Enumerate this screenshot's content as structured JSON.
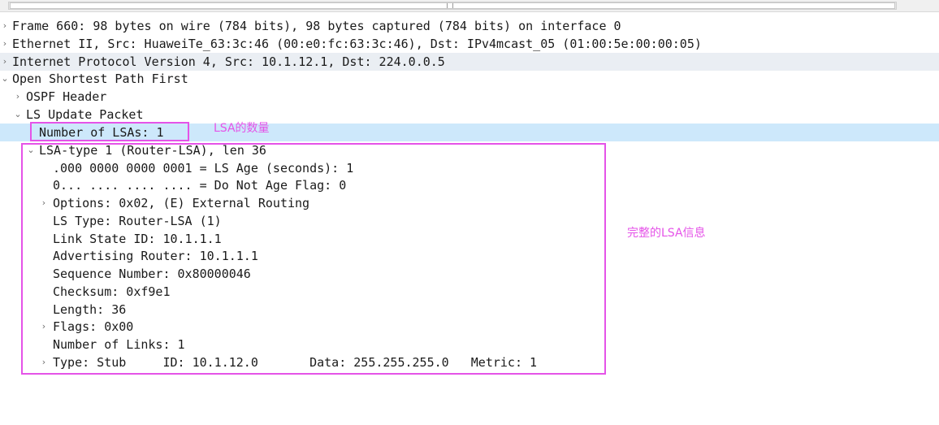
{
  "colors": {
    "annotation": "#e553e8",
    "row_highlight": "#eaeef3",
    "row_selected": "#cde8fb"
  },
  "icons": {
    "collapsed": "chevron-right-icon",
    "expanded": "chevron-down-icon"
  },
  "tree": {
    "frame": "Frame 660: 98 bytes on wire (784 bits), 98 bytes captured (784 bits) on interface 0",
    "ethernet": "Ethernet II, Src: HuaweiTe_63:3c:46 (00:e0:fc:63:3c:46), Dst: IPv4mcast_05 (01:00:5e:00:00:05)",
    "ip": "Internet Protocol Version 4, Src: 10.1.12.1, Dst: 224.0.0.5",
    "ospf": "Open Shortest Path First",
    "ospf_header": "OSPF Header",
    "ls_update": "LS Update Packet",
    "num_lsas": "Number of LSAs: 1",
    "lsa_type": "LSA-type 1 (Router-LSA), len 36",
    "ls_age": ".000 0000 0000 0001 = LS Age (seconds): 1",
    "do_not_age": "0... .... .... .... = Do Not Age Flag: 0",
    "options": "Options: 0x02, (E) External Routing",
    "ls_type": "LS Type: Router-LSA (1)",
    "link_state_id": "Link State ID: 10.1.1.1",
    "adv_router": "Advertising Router: 10.1.1.1",
    "seq_number": "Sequence Number: 0x80000046",
    "checksum": "Checksum: 0xf9e1",
    "length": "Length: 36",
    "flags": "Flags: 0x00",
    "num_links": "Number of Links: 1",
    "link_type": "Type: Stub     ID: 10.1.12.0       Data: 255.255.255.0   Metric: 1"
  },
  "annotations": {
    "num_lsas_note": "LSA的数量",
    "full_lsa_note": "完整的LSA信息"
  }
}
